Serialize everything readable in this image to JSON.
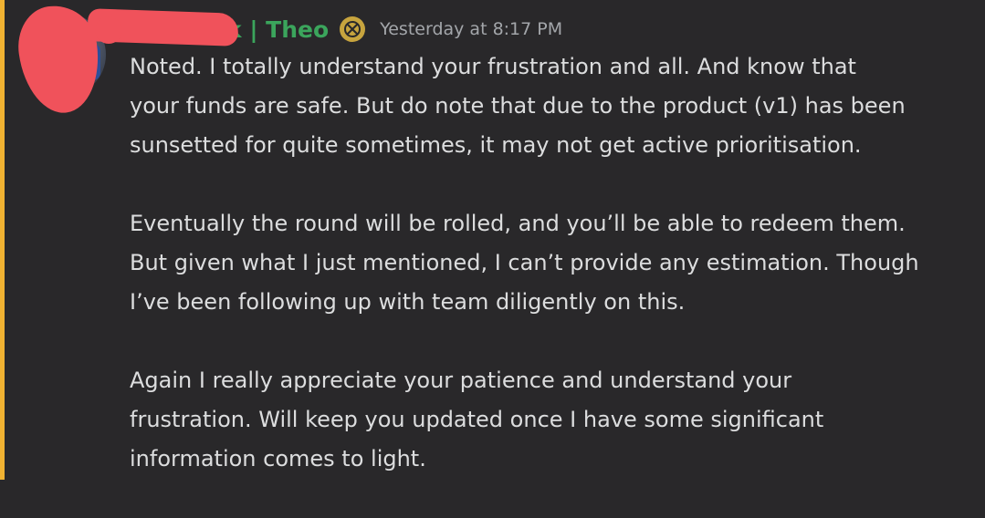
{
  "message": {
    "author": {
      "name_visible": "k | Theo",
      "avatar_icon": "user-avatar",
      "badge_icon": "server-tag-icon"
    },
    "timestamp": "Yesterday at 8:17 PM",
    "paragraphs": [
      {
        "lines": [
          "Noted. I totally understand your frustration and all. And know that",
          "your funds are safe. But do note that due to the product (v1) has been",
          "sunsetted for quite sometimes, it may not get active prioritisation."
        ]
      },
      {
        "lines": [
          "Eventually the round will be rolled, and you’ll be able to redeem them.",
          "But given what I just mentioned, I can’t provide any estimation. Though",
          "I’ve been following up with team diligently on this."
        ]
      },
      {
        "lines": [
          "Again I really appreciate your patience and understand your",
          "frustration. Will keep you updated once I have some significant",
          "information comes to light."
        ]
      }
    ]
  },
  "colors": {
    "background": "#29282a",
    "left_accent": "#f0b232",
    "username": "#3ba55c",
    "text": "#dcddde",
    "timestamp": "#a3a6aa",
    "redaction": "#f0525b"
  }
}
